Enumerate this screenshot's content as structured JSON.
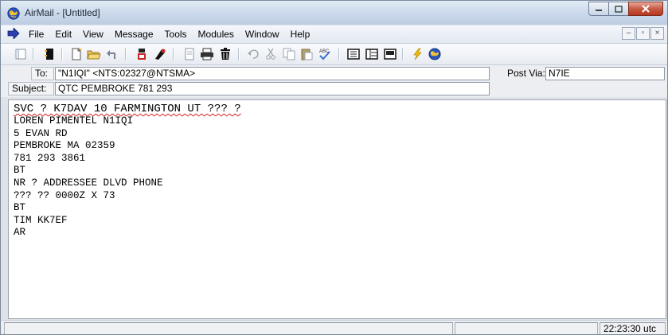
{
  "window": {
    "title": "AirMail - [Untitled]"
  },
  "menu": [
    "File",
    "Edit",
    "View",
    "Message",
    "Tools",
    "Modules",
    "Window",
    "Help"
  ],
  "toolbar": {
    "buttons": [
      "sidebar-toggle",
      "notebook",
      "new-message",
      "open-folder",
      "reply",
      "folder-tree",
      "modules-tree",
      "view-icon",
      "print",
      "delete",
      "undo",
      "cut",
      "copy",
      "paste",
      "spell-check",
      "list-view-1",
      "list-view-2",
      "list-view-3",
      "lightning-send",
      "globe-connect"
    ]
  },
  "address": {
    "to_label": "To:",
    "to_value": "\"N1IQI\" <NTS:02327@NTSMA>",
    "post_via_label": "Post Via:",
    "post_via_value": "N7IE",
    "subject_label": "Subject:",
    "subject_value": "QTC PEMBROKE 781 293"
  },
  "body_lines": [
    "SVC ? K7DAV 10 FARMINGTON UT ??? ?",
    "LOREN PIMENTEL N1IQI",
    "5 EVAN RD",
    "PEMBROKE MA 02359",
    "781 293 3861",
    "BT",
    "NR ? ADDRESSEE DLVD PHONE",
    "??? ?? 0000Z X 73",
    "BT",
    "TIM KK7EF",
    "AR"
  ],
  "status": {
    "time": "22:23:30 utc"
  },
  "colors": {
    "titlebar": "#cad8ea",
    "close_button": "#c75a44",
    "spell_underline": "#d42020"
  }
}
